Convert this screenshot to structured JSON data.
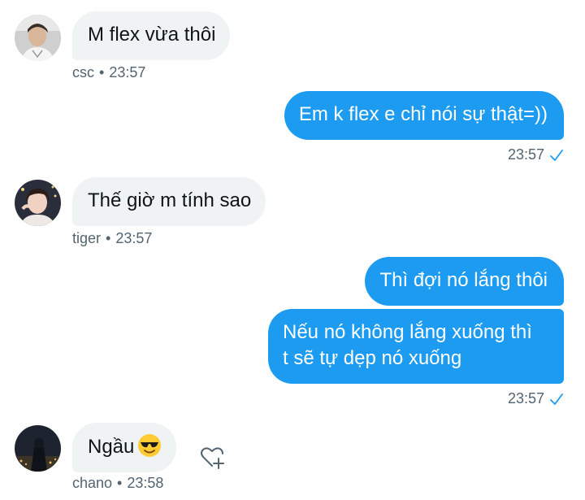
{
  "messages": [
    {
      "id": "m1",
      "direction": "in",
      "text": "M flex vừa thôi",
      "sender": "csc",
      "time": "23:57"
    },
    {
      "id": "m2",
      "direction": "out",
      "text": "Em k flex e chỉ nói sự thật=))",
      "time": "23:57"
    },
    {
      "id": "m3",
      "direction": "in",
      "text": "Thế giờ m tính sao",
      "sender": "tiger",
      "time": "23:57"
    },
    {
      "id": "m4",
      "direction": "out",
      "text": "Thì đợi nó lắng thôi"
    },
    {
      "id": "m5",
      "direction": "out",
      "line1": "Nếu nó không lắng xuống thì",
      "line2": "t sẽ tự dẹp nó xuống",
      "time": "23:57"
    },
    {
      "id": "m6",
      "direction": "in",
      "text": "Ngầu",
      "emoji": "smiling-face-with-sunglasses",
      "sender": "chano",
      "time": "23:58"
    }
  ],
  "separator": "•",
  "icons": {
    "read_receipt": "checkmark-icon",
    "react": "heart-plus-icon"
  },
  "colors": {
    "accent": "#1d9bf0",
    "incoming_bg": "#eff3f4",
    "meta": "#536471"
  }
}
